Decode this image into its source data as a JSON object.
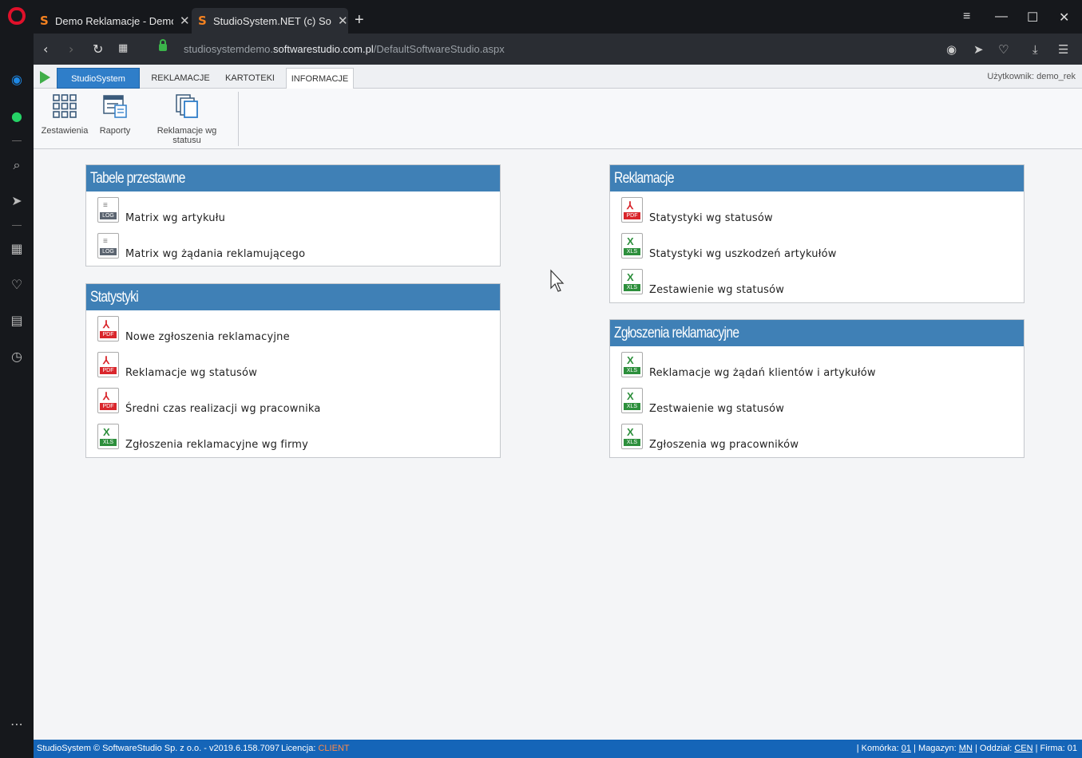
{
  "browser": {
    "tabs": [
      {
        "title": "Demo Reklamacje - Demo"
      },
      {
        "title": "StudioSystem.NET (c) Software"
      }
    ],
    "url_prefix": "studiosystemdemo.",
    "url_domain": "softwarestudio.com.pl",
    "url_path": "/DefaultSoftwareStudio.aspx"
  },
  "menu": {
    "brand": "StudioSystem",
    "tabs": [
      "REKLAMACJE",
      "KARTOTEKI",
      "INFORMACJE"
    ],
    "selected": "INFORMACJE",
    "user": "Użytkownik: demo_rek"
  },
  "ribbon": {
    "buttons": [
      "Zestawienia",
      "Raporty",
      "Reklamacje wg statusu"
    ]
  },
  "panels": {
    "tabele": {
      "title": "Tabele przestawne",
      "items": [
        {
          "type": "LOG",
          "label": "Matrix wg artykułu"
        },
        {
          "type": "LOG",
          "label": "Matrix wg żądania reklamującego"
        }
      ]
    },
    "statystyki": {
      "title": "Statystyki",
      "items": [
        {
          "type": "PDF",
          "label": "Nowe zgłoszenia reklamacyjne"
        },
        {
          "type": "PDF",
          "label": "Reklamacje wg statusów"
        },
        {
          "type": "PDF",
          "label": "Średni czas realizacji wg pracownika"
        },
        {
          "type": "XLS",
          "label": "Zgłoszenia reklamacyjne wg firmy"
        }
      ]
    },
    "reklamacje": {
      "title": "Reklamacje",
      "items": [
        {
          "type": "PDF",
          "label": "Statystyki wg statusów"
        },
        {
          "type": "XLS",
          "label": "Statystyki wg uszkodzeń artykułów"
        },
        {
          "type": "XLS",
          "label": "Zestawienie wg statusów"
        }
      ]
    },
    "zgloszenia": {
      "title": "Zgłoszenia reklamacyjne",
      "items": [
        {
          "type": "XLS",
          "label": "Reklamacje wg żądań klientów i artykułów"
        },
        {
          "type": "XLS",
          "label": "Zestwaienie wg statusów"
        },
        {
          "type": "XLS",
          "label": "Zgłoszenia wg pracowników"
        }
      ]
    }
  },
  "status": {
    "copyright": "StudioSystem © SoftwareStudio Sp. z o.o. - v2019.6.158.7097",
    "license_label": "Licencja:",
    "license_value": "CLIENT",
    "komorka_label": "Komórka:",
    "komorka_value": "01",
    "magazyn_label": "Magazyn:",
    "magazyn_value": "MN",
    "oddzial_label": "Oddział:",
    "oddzial_value": "CEN",
    "firma": "Firma: 01"
  },
  "colors": {
    "panel_header": "#3f80b6",
    "brand_tab": "#2f7ec9",
    "statusbar": "#1565b8",
    "license": "#ff8a4a"
  }
}
